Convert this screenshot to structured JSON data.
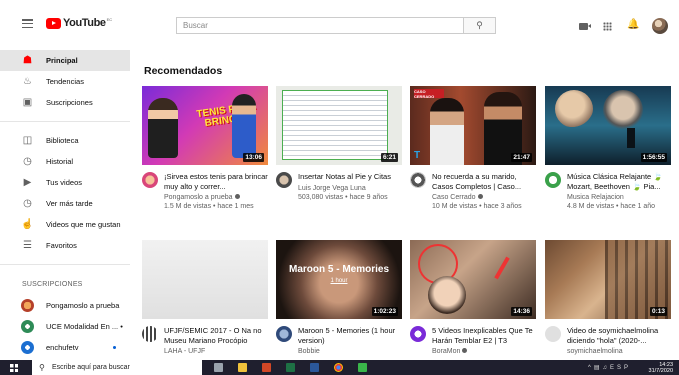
{
  "header": {
    "logo_text": "YouTube",
    "logo_sup": "EC",
    "search_placeholder": "Buscar",
    "icons": [
      "menu-icon",
      "search-icon",
      "create-video-icon",
      "apps-icon",
      "bell-icon"
    ]
  },
  "sidebar": {
    "items": [
      {
        "label": "Principal",
        "icon": "home-icon",
        "active": true
      },
      {
        "label": "Tendencias",
        "icon": "fire-icon"
      },
      {
        "label": "Suscripciones",
        "icon": "subscriptions-icon"
      },
      {
        "label": "Biblioteca",
        "icon": "library-icon"
      },
      {
        "label": "Historial",
        "icon": "history-icon"
      },
      {
        "label": "Tus videos",
        "icon": "my-videos-icon"
      },
      {
        "label": "Ver más tarde",
        "icon": "clock-icon"
      },
      {
        "label": "Videos que me gustan",
        "icon": "thumbs-up-icon"
      },
      {
        "label": "Favoritos",
        "icon": "playlist-icon"
      }
    ],
    "subscriptions_heading": "SUSCRIPCIONES",
    "subscriptions": [
      {
        "label": "Pongamoslo a prueba"
      },
      {
        "label": "UCE Modalidad En ... •"
      },
      {
        "label": "enchufetv"
      }
    ]
  },
  "main": {
    "section_title": "Recomendados",
    "videos": [
      {
        "title": "¡Sirvea estos tenis para brincar muy alto y correr...",
        "channel": "Pongamoslo a prueba",
        "stats": "1.5 M de vistas • hace 1 mes",
        "duration": "13:06",
        "thumb_text": "TENIS PARA BRINCAR"
      },
      {
        "title": "Insertar Notas al Pie y Citas",
        "channel": "Luis Jorge Vega Luna",
        "stats": "503,080 vistas • hace 9 años",
        "duration": "6:21"
      },
      {
        "title": "No recuerda a su marido, Casos Completos | Caso...",
        "channel": "Caso Cerrado",
        "stats": "10 M de vistas • hace 3 años",
        "duration": "21:47",
        "thumb_logo": "CASO CERRADO",
        "thumb_brand": "T"
      },
      {
        "title": "Música Clásica Relajante 🍃 Mozart, Beethoven 🍃 Pia...",
        "channel": "Musica Relajacion",
        "stats": "4.8 M de vistas • hace 1 año",
        "duration": "1:56:55"
      },
      {
        "title": "UFJF/SEMIC 2017 - O Na no Museu Mariano Procópio",
        "channel": "LAHA - UFJF",
        "stats": "",
        "duration": ""
      },
      {
        "title": "Maroon 5 - Memories (1 hour version)",
        "channel": "Bobbie",
        "stats": "",
        "duration": "1:02:23",
        "thumb_text": "Maroon 5 - Memories",
        "thumb_sub": "1 hour"
      },
      {
        "title": "5 Videos Inexplicables Que Te Harán Temblar E2 | T3",
        "channel": "BoraMon",
        "stats": "",
        "duration": "14:36"
      },
      {
        "title": "Video de soymichaelmolina diciendo \"hola\" (2020-...",
        "channel": "soymichaelmolina",
        "stats": "",
        "duration": "0:13"
      }
    ]
  },
  "taskbar": {
    "search_placeholder": "Escribe aquí para buscar",
    "lang": "ESP",
    "time": "14:23",
    "date": "31/7/2020"
  },
  "colors": {
    "brand": "#ff0000",
    "taskbar": "#1f1f2e",
    "active_bg": "#e5e5e5"
  }
}
